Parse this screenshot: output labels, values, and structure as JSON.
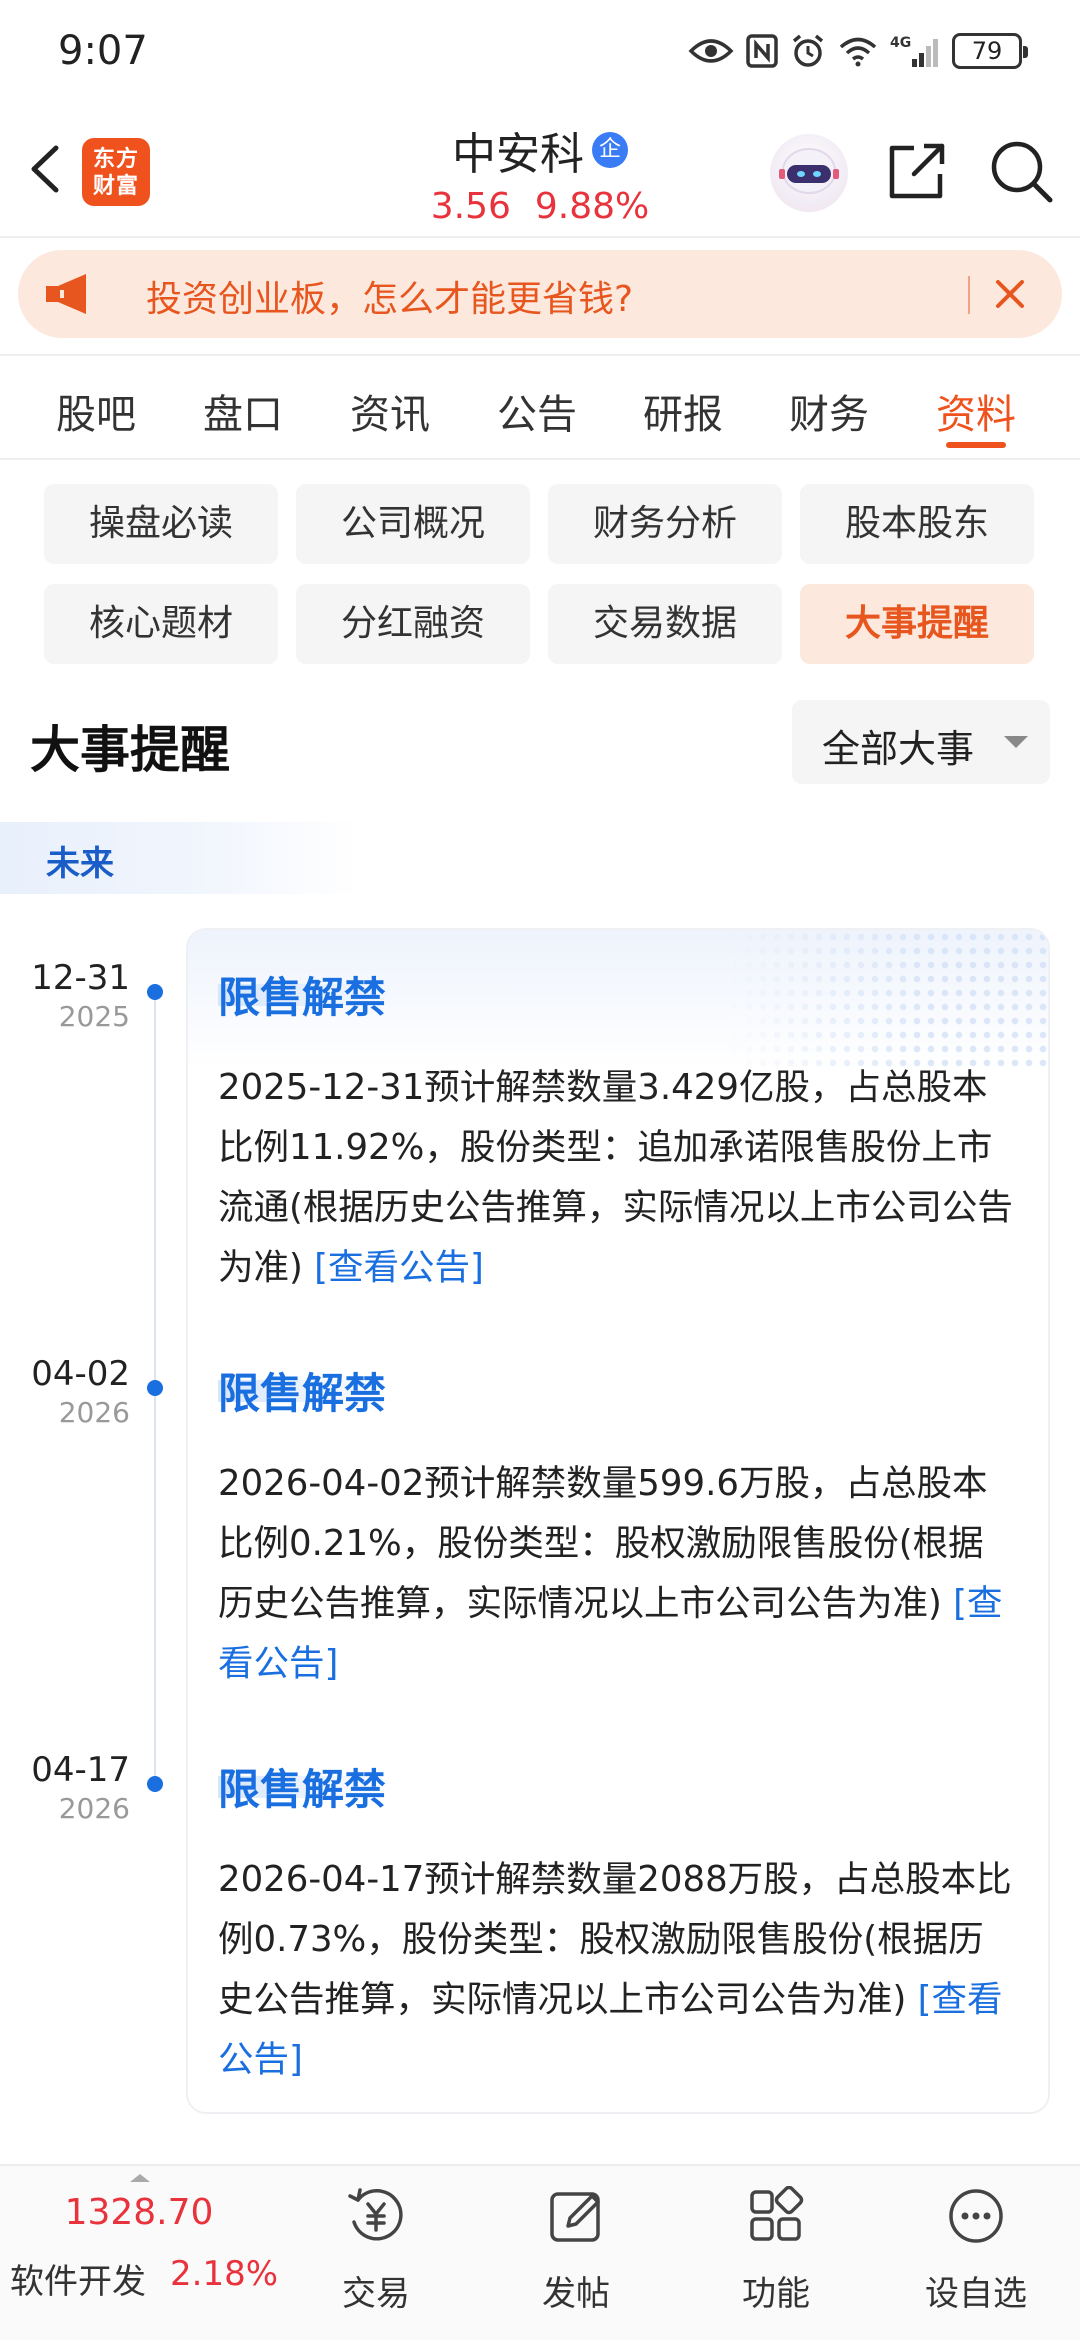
{
  "status_bar": {
    "time": "9:07",
    "network": "4G",
    "battery": "79"
  },
  "header": {
    "brand_logo": [
      "东方",
      "财富"
    ],
    "stock_name": "中安科",
    "enterprise_badge": "企",
    "price": "3.56",
    "change_pct": "9.88%",
    "icons": [
      "back-arrow-icon",
      "robot-assistant-icon",
      "share-icon",
      "search-icon"
    ]
  },
  "banner": {
    "text": "投资创业板，怎么才能更省钱?",
    "icon": "megaphone-icon"
  },
  "tabs": {
    "items": [
      "股吧",
      "盘口",
      "资讯",
      "公告",
      "研报",
      "财务",
      "资料"
    ],
    "active_index": 6
  },
  "sub_nav": {
    "items": [
      "操盘必读",
      "公司概况",
      "财务分析",
      "股本股东",
      "核心题材",
      "分红融资",
      "交易数据",
      "大事提醒"
    ],
    "active_index": 7
  },
  "section": {
    "title": "大事提醒",
    "filter_label": "全部大事",
    "group_label": "未来"
  },
  "events": [
    {
      "date": "12-31",
      "year": "2025",
      "title": "限售解禁",
      "description": "2025-12-31预计解禁数量3.429亿股，占总股本比例11.92%，股份类型：追加承诺限售股份上市流通(根据历史公告推算，实际情况以上市公司公告为准) ",
      "link": "[查看公告]"
    },
    {
      "date": "04-02",
      "year": "2026",
      "title": "限售解禁",
      "description": "2026-04-02预计解禁数量599.6万股，占总股本比例0.21%，股份类型：股权激励限售股份(根据历史公告推算，实际情况以上市公司公告为准) ",
      "link": "[查看公告]"
    },
    {
      "date": "04-17",
      "year": "2026",
      "title": "限售解禁",
      "description": "2026-04-17预计解禁数量2088万股，占总股本比例0.73%，股份类型：股权激励限售股份(根据历史公告推算，实际情况以上市公司公告为准) ",
      "link": "[查看公告]"
    }
  ],
  "bottom_bar": {
    "index_value": "1328.70",
    "index_name": "软件开发",
    "index_change": "2.18%",
    "items": [
      {
        "label": "交易",
        "icon": "trade-yen-icon"
      },
      {
        "label": "发帖",
        "icon": "compose-icon"
      },
      {
        "label": "功能",
        "icon": "apps-grid-icon"
      },
      {
        "label": "设自选",
        "icon": "more-dots-icon"
      }
    ]
  },
  "colors": {
    "brand_orange": "#f0521e",
    "price_red": "#e8323c",
    "link_blue": "#1a6fe0"
  }
}
